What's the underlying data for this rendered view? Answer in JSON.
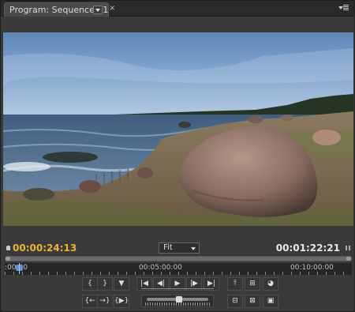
{
  "tab": {
    "title": "Program: Sequence 01",
    "close": "×"
  },
  "timecode": {
    "current": "00:00:24:13",
    "duration": "00:01:22:21"
  },
  "zoom": {
    "selected": "Fit"
  },
  "ruler": {
    "labels": [
      ":00:00",
      "00:05:00:00",
      "00:10:00:00"
    ]
  },
  "playhead": {
    "position_fraction": 0.02
  },
  "transport": {
    "row1": [
      {
        "name": "mark-in-button",
        "glyph": "{"
      },
      {
        "name": "mark-out-button",
        "glyph": "}"
      },
      {
        "name": "set-marker-button",
        "glyph": "▼"
      },
      {
        "name": "go-to-in-button",
        "glyph": "|◀"
      },
      {
        "name": "step-back-button",
        "glyph": "◀|"
      },
      {
        "name": "play-button",
        "glyph": "▶"
      },
      {
        "name": "step-forward-button",
        "glyph": "|▶"
      },
      {
        "name": "go-to-out-button",
        "glyph": "▶|"
      },
      {
        "name": "lift-button",
        "glyph": "⤒"
      },
      {
        "name": "safe-margins-button",
        "glyph": "⊞"
      },
      {
        "name": "output-button",
        "glyph": "◕"
      }
    ],
    "row2": [
      {
        "name": "go-to-previous-edit-button",
        "glyph": "{←"
      },
      {
        "name": "go-to-next-edit-button",
        "glyph": "→}"
      },
      {
        "name": "play-in-to-out-button",
        "glyph": "{▶}"
      },
      {
        "name": "trim-monitor-button",
        "glyph": "⊟"
      },
      {
        "name": "extract-button",
        "glyph": "⊠"
      },
      {
        "name": "export-frame-button",
        "glyph": "▣"
      }
    ]
  },
  "colors": {
    "accent_timecode": "#f0b428",
    "playhead": "#5d8fd6"
  }
}
